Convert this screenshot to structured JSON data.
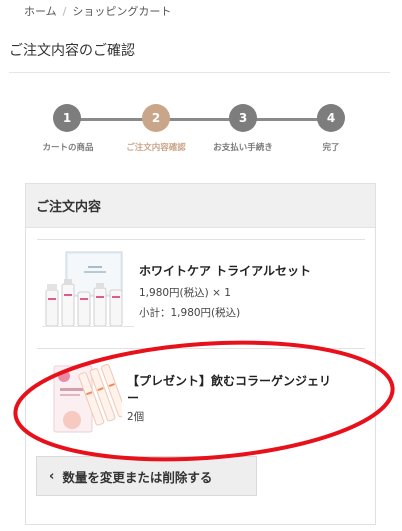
{
  "breadcrumb": {
    "home": "ホーム",
    "separator": "/",
    "current": "ショッピングカート"
  },
  "page_title": "ご注文内容のご確認",
  "steps": [
    {
      "number": "1",
      "label": "カートの商品",
      "active": false
    },
    {
      "number": "2",
      "label": "ご注文内容確認",
      "active": true
    },
    {
      "number": "3",
      "label": "お支払い手続き",
      "active": false
    },
    {
      "number": "4",
      "label": "完了",
      "active": false
    }
  ],
  "order": {
    "header": "ご注文内容",
    "items": [
      {
        "name": "ホワイトケア トライアルセット",
        "price_line": "1,980円(税込) × 1",
        "subtotal_line": "小計：1,980円(税込)"
      },
      {
        "name_line1": "【プレゼント】飲むコラーゲンジェリ",
        "name_line2": "ー",
        "quantity_line": "2個"
      }
    ],
    "change_button": "数量を変更または削除する",
    "chevron": "‹"
  },
  "colors": {
    "active_step": "#c9a58a",
    "inactive_step": "#7d7d7d",
    "annotation": "#e8101a"
  }
}
